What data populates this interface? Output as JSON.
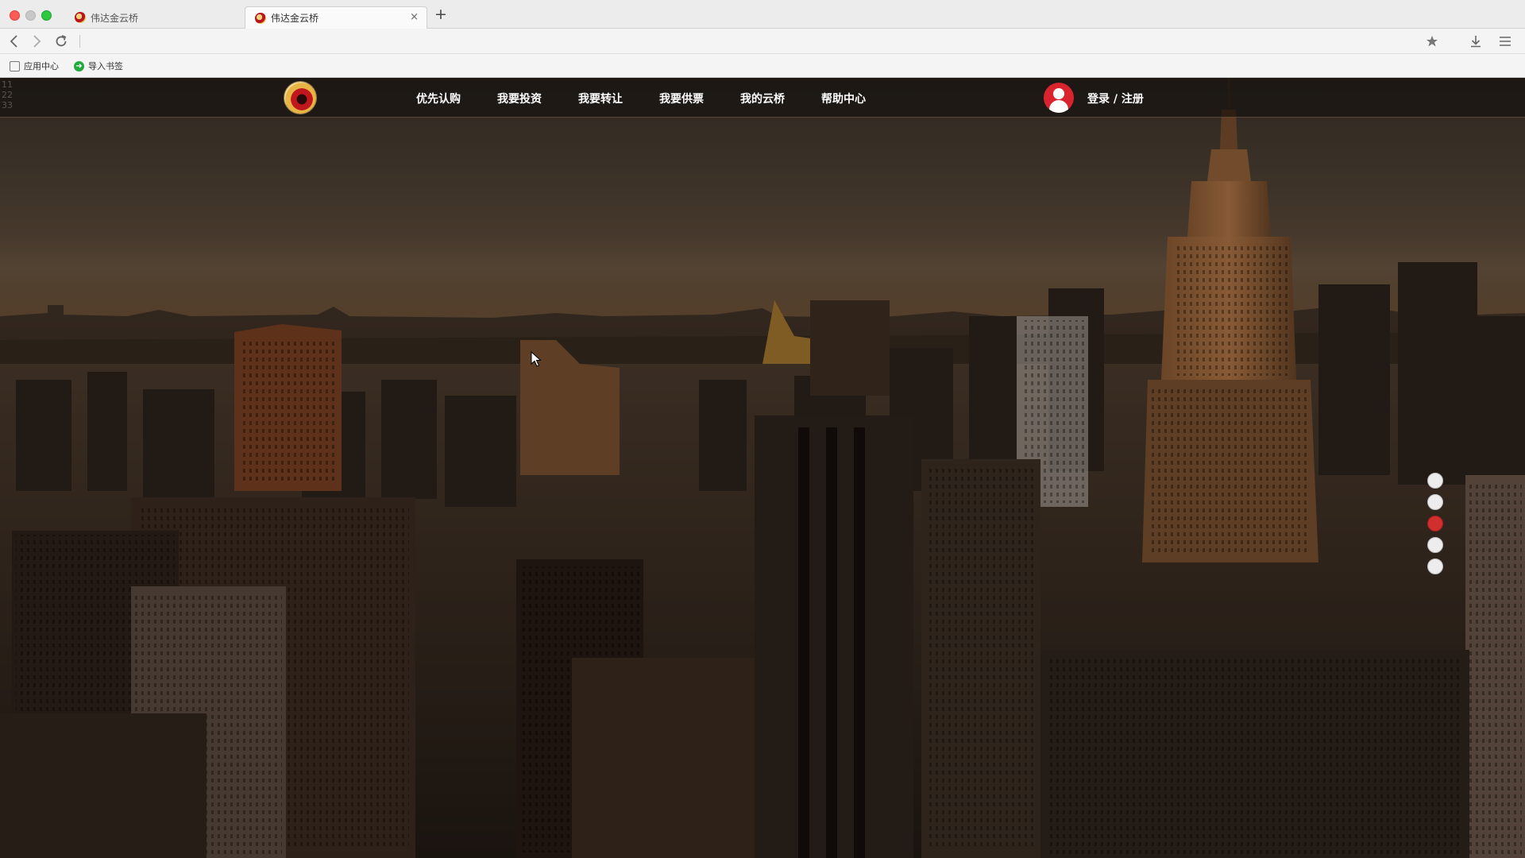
{
  "browser": {
    "tabs": [
      {
        "title": "伟达金云桥",
        "active": false
      },
      {
        "title": "伟达金云桥",
        "active": true
      }
    ],
    "new_tab_glyph": "+",
    "close_glyph": "×",
    "bookmarks": [
      {
        "label": "应用中心",
        "icon": "apps-icon"
      },
      {
        "label": "导入书签",
        "icon": "import-icon"
      }
    ],
    "import_glyph": "➜"
  },
  "page": {
    "debug_numbers": [
      "11",
      "22",
      "33"
    ],
    "nav": {
      "items": [
        "优先认购",
        "我要投资",
        "我要转让",
        "我要供票",
        "我的云桥",
        "帮助中心"
      ],
      "login_label": "登录 / 注册"
    },
    "slider": {
      "count": 5,
      "active_index": 2,
      "active_color": "#d12e2e"
    }
  }
}
